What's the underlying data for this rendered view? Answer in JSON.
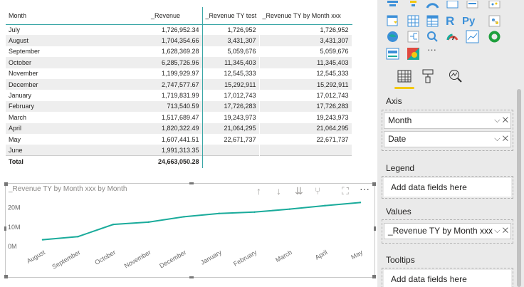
{
  "table": {
    "headers": [
      "Month",
      "_Revenue",
      "_Revenue TY test",
      "_Revenue TY by Month xxx"
    ],
    "rows": [
      [
        "July",
        "1,726,952.34",
        "1,726,952",
        "1,726,952"
      ],
      [
        "August",
        "1,704,354.66",
        "3,431,307",
        "3,431,307"
      ],
      [
        "September",
        "1,628,369.28",
        "5,059,676",
        "5,059,676"
      ],
      [
        "October",
        "6,285,726.96",
        "11,345,403",
        "11,345,403"
      ],
      [
        "November",
        "1,199,929.97",
        "12,545,333",
        "12,545,333"
      ],
      [
        "December",
        "2,747,577.67",
        "15,292,911",
        "15,292,911"
      ],
      [
        "January",
        "1,719,831.99",
        "17,012,743",
        "17,012,743"
      ],
      [
        "February",
        "713,540.59",
        "17,726,283",
        "17,726,283"
      ],
      [
        "March",
        "1,517,689.47",
        "19,243,973",
        "19,243,973"
      ],
      [
        "April",
        "1,820,322.49",
        "21,064,295",
        "21,064,295"
      ],
      [
        "May",
        "1,607,441.51",
        "22,671,737",
        "22,671,737"
      ],
      [
        "June",
        "1,991,313.35",
        "",
        ""
      ]
    ],
    "total": [
      "Total",
      "24,663,050.28",
      "",
      ""
    ]
  },
  "line_visual": {
    "title": "_Revenue TY by Month xxx by Month",
    "toolbar": [
      "drill-up-icon",
      "drill-down-icon",
      "expand-all-down-icon",
      "expand-next-level-icon",
      "focus-mode-icon",
      "more-options-icon"
    ],
    "more_label": "···"
  },
  "chart_data": {
    "type": "line",
    "categories": [
      "August",
      "September",
      "October",
      "November",
      "December",
      "January",
      "February",
      "March",
      "April",
      "May"
    ],
    "series": [
      {
        "values": [
          3431307,
          5059676,
          11345403,
          12545333,
          15292911,
          17012743,
          17726283,
          19243973,
          21064295,
          22671737
        ]
      }
    ],
    "yticks": [
      "20M",
      "10M",
      "0M"
    ],
    "ytick_values": [
      20000000,
      10000000,
      0
    ],
    "ylim": [
      0,
      25000000
    ],
    "line_color": "#1aab9b"
  },
  "pane": {
    "more_visuals": "···",
    "tabs": [
      "fields-tab-icon",
      "format-tab-icon",
      "analytics-tab-icon"
    ],
    "axis_label": "Axis",
    "axis_fields": [
      "Month",
      "Date"
    ],
    "legend_label": "Legend",
    "legend_placeholder": "Add data fields here",
    "values_label": "Values",
    "values_fields": [
      "_Revenue TY by Month xxx"
    ],
    "tooltips_label": "Tooltips",
    "tooltips_placeholder": "Add data fields here",
    "accent": "#f2c811"
  }
}
